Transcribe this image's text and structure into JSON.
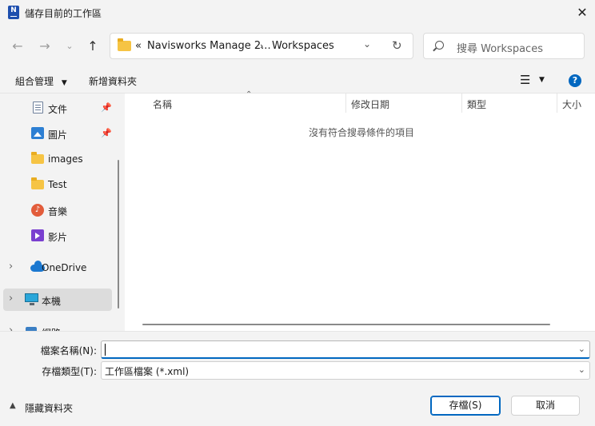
{
  "window": {
    "title": "儲存目前的工作區"
  },
  "address_bar": {
    "overflow": "«",
    "segments": [
      "Navisworks Manage 2...",
      "Workspaces"
    ]
  },
  "search": {
    "placeholder": "搜尋 Workspaces"
  },
  "command_bar": {
    "organize": "組合管理",
    "new_folder": "新增資料夾",
    "help": "?"
  },
  "nav_pane": {
    "items": [
      {
        "label": "文件",
        "icon": "document-icon",
        "pinned": true
      },
      {
        "label": "圖片",
        "icon": "pictures-icon",
        "pinned": true
      },
      {
        "label": "images",
        "icon": "folder-icon",
        "pinned": false
      },
      {
        "label": "Test",
        "icon": "folder-icon",
        "pinned": false
      },
      {
        "label": "音樂",
        "icon": "music-icon",
        "pinned": false
      },
      {
        "label": "影片",
        "icon": "video-icon",
        "pinned": false
      },
      {
        "label": "OneDrive",
        "icon": "onedrive-icon",
        "expandable": true
      },
      {
        "label": "本機",
        "icon": "this-pc-icon",
        "expandable": true,
        "selected": true
      },
      {
        "label": "網路",
        "icon": "network-icon",
        "expandable": true
      }
    ]
  },
  "file_list": {
    "columns": [
      "名稱",
      "修改日期",
      "類型",
      "大小"
    ],
    "empty_message": "沒有符合搜尋條件的項目"
  },
  "form": {
    "filename_label": "檔案名稱(N):",
    "filename_value": "",
    "filetype_label": "存檔類型(T):",
    "filetype_value": "工作區檔案 (*.xml)"
  },
  "footer": {
    "hide_folders": "隱藏資料夾",
    "save": "存檔(S)",
    "cancel": "取消"
  }
}
